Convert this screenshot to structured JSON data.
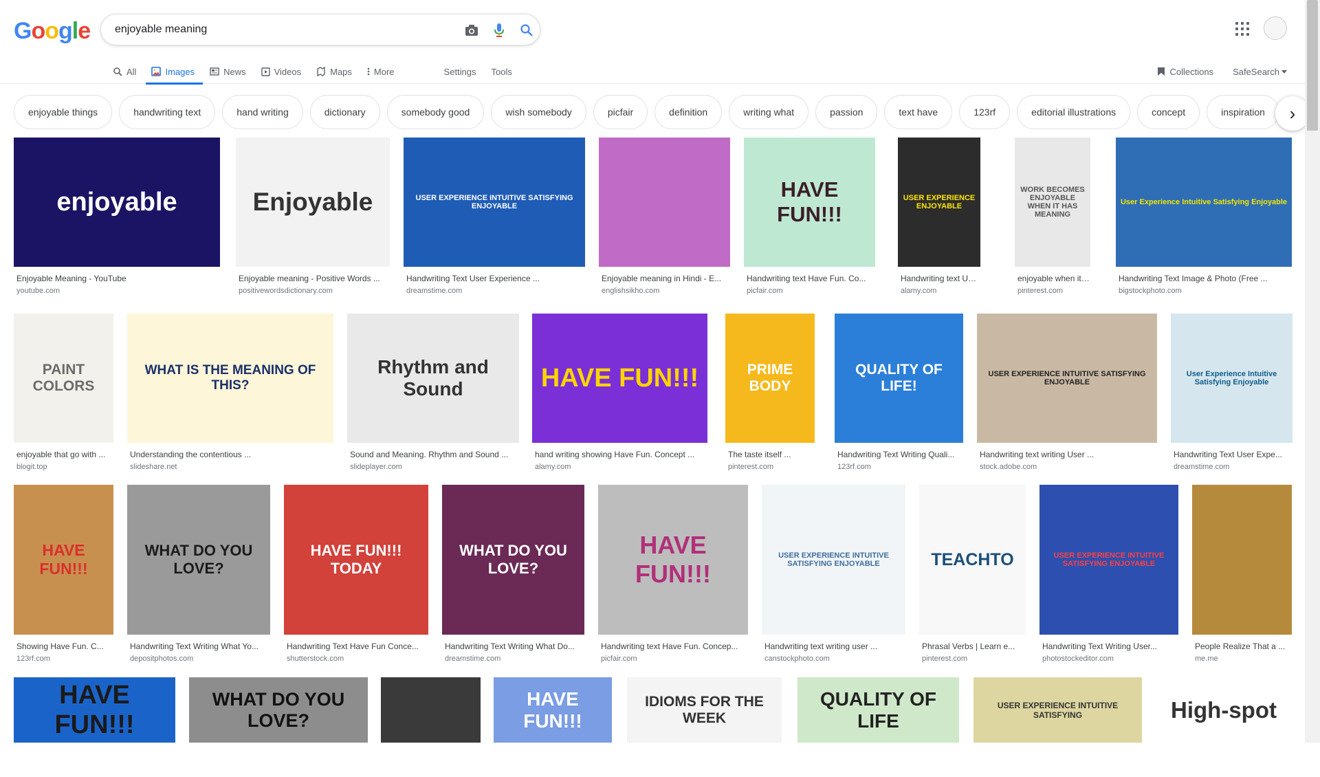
{
  "logo": {
    "letters": [
      "G",
      "o",
      "o",
      "g",
      "l",
      "e"
    ]
  },
  "search": {
    "value": "enjoyable meaning"
  },
  "tabs": [
    {
      "label": "All",
      "icon": "search-icon"
    },
    {
      "label": "Images",
      "icon": "image-icon",
      "active": true
    },
    {
      "label": "News",
      "icon": "news-icon"
    },
    {
      "label": "Videos",
      "icon": "video-icon"
    },
    {
      "label": "Maps",
      "icon": "map-icon"
    },
    {
      "label": "More",
      "icon": "more-icon"
    }
  ],
  "tools": {
    "settings": "Settings",
    "tools": "Tools"
  },
  "right": {
    "collections": "Collections",
    "safesearch": "SafeSearch"
  },
  "chips": [
    "enjoyable things",
    "handwriting text",
    "hand writing",
    "dictionary",
    "somebody good",
    "wish somebody",
    "picfair",
    "definition",
    "writing what",
    "passion",
    "text have",
    "123rf",
    "editorial illustrations",
    "concept",
    "inspiration"
  ],
  "results": [
    {
      "caption": "Enjoyable Meaning - YouTube",
      "source": "youtube.com",
      "thumb_text": "enjoyable",
      "bg": "#1b1464",
      "fg": "#ffffff"
    },
    {
      "caption": "Enjoyable meaning - Positive Words ...",
      "source": "positivewordsdictionary.com",
      "thumb_text": "Enjoyable",
      "bg": "#f2f2f2",
      "fg": "#333333"
    },
    {
      "caption": "Handwriting Text User Experience ...",
      "source": "dreamstime.com",
      "thumb_text": "USER EXPERIENCE INTUITIVE SATISFYING ENJOYABLE",
      "bg": "#1f5cb6",
      "fg": "#ffffff"
    },
    {
      "caption": "Enjoyable meaning in Hindi - E...",
      "source": "englishsikho.com",
      "thumb_text": "",
      "bg": "#c06bc6",
      "fg": "#000000"
    },
    {
      "caption": "Handwriting text Have Fun. Co...",
      "source": "picfair.com",
      "thumb_text": "HAVE FUN!!!",
      "bg": "#bfe8d2",
      "fg": "#3a1f2a"
    },
    {
      "caption": "Handwriting text User ...",
      "source": "alamy.com",
      "thumb_text": "USER EXPERIENCE ENJOYABLE",
      "bg": "#2c2c2c",
      "fg": "#ffe600"
    },
    {
      "caption": "enjoyable when it has ...",
      "source": "pinterest.com",
      "thumb_text": "WORK BECOMES ENJOYABLE WHEN IT HAS MEANING",
      "bg": "#e8e8e8",
      "fg": "#555555"
    },
    {
      "caption": "Handwriting Text Image & Photo (Free ...",
      "source": "bigstockphoto.com",
      "thumb_text": "User Experience Intuitive Satisfying Enjoyable",
      "bg": "#2f6db5",
      "fg": "#f2e600"
    },
    {
      "caption": "enjoyable that go with ...",
      "source": "blogit.top",
      "thumb_text": "PAINT COLORS",
      "bg": "#f3f1ec",
      "fg": "#6b6b6b"
    },
    {
      "caption": "Understanding the contentious ...",
      "source": "slideshare.net",
      "thumb_text": "WHAT IS THE MEANING OF THIS?",
      "bg": "#fdf6d8",
      "fg": "#1b2f6b"
    },
    {
      "caption": "Sound and Meaning. Rhythm and Sound ...",
      "source": "slideplayer.com",
      "thumb_text": "Rhythm and Sound",
      "bg": "#e9e9e9",
      "fg": "#333333"
    },
    {
      "caption": "hand writing showing Have Fun. Concept ...",
      "source": "alamy.com",
      "thumb_text": "HAVE FUN!!!",
      "bg": "#7b2fd6",
      "fg": "#ffd400"
    },
    {
      "caption": "The taste itself ...",
      "source": "pinterest.com",
      "thumb_text": "PRIME BODY",
      "bg": "#f6b91d",
      "fg": "#ffffff"
    },
    {
      "caption": "Handwriting Text Writing Quali...",
      "source": "123rf.com",
      "thumb_text": "QUALITY OF LIFE!",
      "bg": "#2b7fd9",
      "fg": "#ffffff"
    },
    {
      "caption": "Handwriting text writing User ...",
      "source": "stock.adobe.com",
      "thumb_text": "USER EXPERIENCE INTUITIVE SATISFYING ENJOYABLE",
      "bg": "#c9b9a4",
      "fg": "#222222"
    },
    {
      "caption": "Handwriting Text User Expe...",
      "source": "dreamstime.com",
      "thumb_text": "User Experience Intuitive Satisfying Enjoyable",
      "bg": "#d6e6ee",
      "fg": "#0f5c8a"
    },
    {
      "caption": "Showing Have Fun. C...",
      "source": "123rf.com",
      "thumb_text": "HAVE FUN!!!",
      "bg": "#c8904f",
      "fg": "#d9302c"
    },
    {
      "caption": "Handwriting Text Writing What Yo...",
      "source": "depositphotos.com",
      "thumb_text": "WHAT DO YOU LOVE?",
      "bg": "#9a9a9a",
      "fg": "#1b1b1b"
    },
    {
      "caption": "Handwriting Text Have Fun Conce...",
      "source": "shutterstock.com",
      "thumb_text": "HAVE FUN!!! TODAY",
      "bg": "#d2413a",
      "fg": "#ffffff"
    },
    {
      "caption": "Handwriting Text Writing What Do...",
      "source": "dreamstime.com",
      "thumb_text": "WHAT DO YOU LOVE?",
      "bg": "#6b2a56",
      "fg": "#ffffff"
    },
    {
      "caption": "Handwriting text Have Fun. Concep...",
      "source": "picfair.com",
      "thumb_text": "HAVE FUN!!!",
      "bg": "#bdbdbd",
      "fg": "#b03079"
    },
    {
      "caption": "Handwriting text writing user ...",
      "source": "canstockphoto.com",
      "thumb_text": "USER EXPERIENCE INTUITIVE SATISFYING ENJOYABLE",
      "bg": "#f1f5f8",
      "fg": "#3d6c9b"
    },
    {
      "caption": "Phrasal Verbs | Learn e...",
      "source": "pinterest.com",
      "thumb_text": "TEACHTO",
      "bg": "#f8f8f8",
      "fg": "#1b4f7a"
    },
    {
      "caption": "Handwriting Text Writing User...",
      "source": "photostockeditor.com",
      "thumb_text": "USER EXPERIENCE INTUITIVE SATISFYING ENJOYABLE",
      "bg": "#2d4fb0",
      "fg": "#ff4040"
    },
    {
      "caption": "People Realize That a ...",
      "source": "me.me",
      "thumb_text": "",
      "bg": "#b58a3d",
      "fg": "#2a1a05"
    },
    {
      "caption": "",
      "source": "",
      "thumb_text": "HAVE FUN!!!",
      "bg": "#1a64c9",
      "fg": "#1a1a1a"
    },
    {
      "caption": "",
      "source": "",
      "thumb_text": "WHAT DO YOU LOVE?",
      "bg": "#8d8d8d",
      "fg": "#111111"
    },
    {
      "caption": "",
      "source": "",
      "thumb_text": "",
      "bg": "#3a3a3a",
      "fg": "#ffffff"
    },
    {
      "caption": "",
      "source": "",
      "thumb_text": "HAVE FUN!!!",
      "bg": "#7a9de3",
      "fg": "#ffffff"
    },
    {
      "caption": "",
      "source": "",
      "thumb_text": "IDIOMS FOR THE WEEK",
      "bg": "#f4f4f4",
      "fg": "#333333"
    },
    {
      "caption": "",
      "source": "",
      "thumb_text": "QUALITY OF LIFE",
      "bg": "#cfe8c9",
      "fg": "#222222"
    },
    {
      "caption": "",
      "source": "",
      "thumb_text": "USER EXPERIENCE INTUITIVE SATISFYING",
      "bg": "#ddd6a0",
      "fg": "#333333"
    },
    {
      "caption": "",
      "source": "",
      "thumb_text": "High-spot",
      "bg": "#ffffff",
      "fg": "#333333"
    }
  ],
  "colors": {
    "accent": "#1a73e8",
    "text_secondary": "#5f6368",
    "chip_border": "#dfe1e5"
  }
}
